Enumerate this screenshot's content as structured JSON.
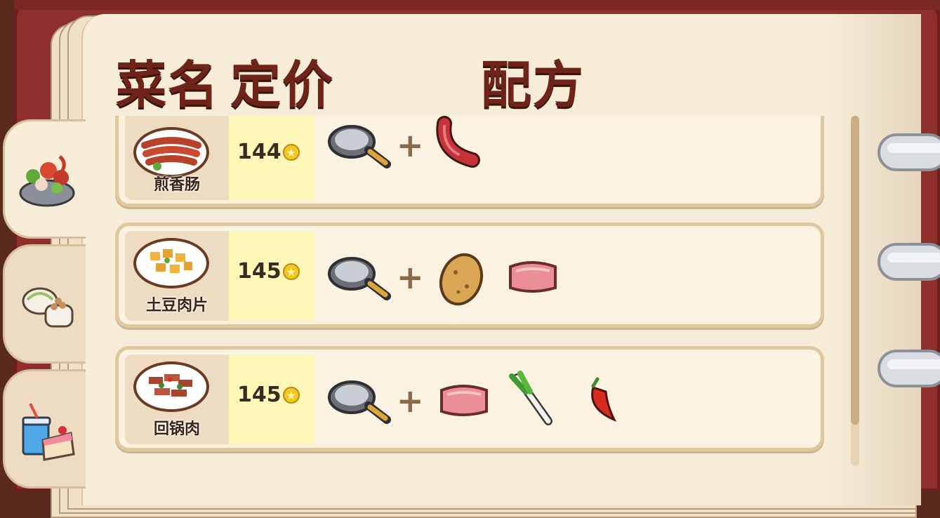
{
  "header": {
    "col_name": "菜名",
    "col_price": "定价",
    "col_recipe": "配方"
  },
  "tabs": [
    {
      "icon": "salad-bowl-icon"
    },
    {
      "icon": "dumplings-icon"
    },
    {
      "icon": "drink-cake-icon"
    }
  ],
  "dishes": [
    {
      "name": "煎香肠",
      "price": "144",
      "tool": "frying-pan-icon",
      "ingredients": [
        "sausage-icon"
      ]
    },
    {
      "name": "土豆肉片",
      "price": "145",
      "tool": "frying-pan-icon",
      "ingredients": [
        "potato-icon",
        "pork-icon"
      ]
    },
    {
      "name": "回锅肉",
      "price": "145",
      "tool": "frying-pan-icon",
      "ingredients": [
        "pork-icon",
        "green-onion-icon",
        "chili-pepper-icon"
      ]
    }
  ],
  "plus_sign": "+",
  "colors": {
    "cover": "#8e2f2b",
    "page": "#f6ecd7",
    "header_text": "#6e2418",
    "price_bg": "#fff7b8",
    "coin": "#f3c623"
  }
}
